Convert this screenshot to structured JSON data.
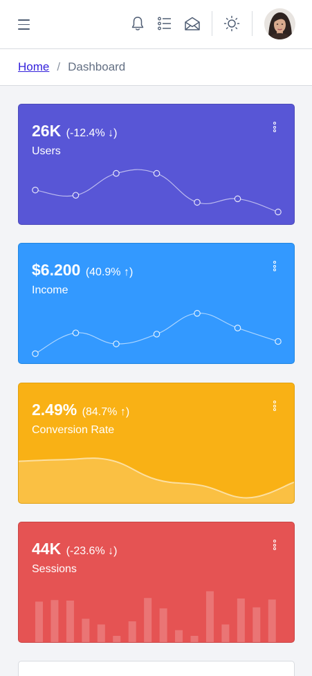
{
  "header": {
    "menu_icon": "hamburger-icon",
    "icons": [
      "bell-icon",
      "list-icon",
      "envelope-open-icon",
      "sun-icon"
    ],
    "avatar": "user-avatar"
  },
  "breadcrumb": {
    "home": "Home",
    "separator": "/",
    "current": "Dashboard"
  },
  "widgets": [
    {
      "value": "26K",
      "change": "(-12.4% ↓)",
      "label": "Users",
      "color": "#5856d6",
      "border_color": "#4b49b8",
      "chart": {
        "type": "line",
        "values": [
          65,
          59,
          84,
          84,
          51,
          55,
          40
        ],
        "ylim": [
          30,
          90
        ]
      }
    },
    {
      "value": "$6.200",
      "change": "(40.9% ↑)",
      "label": "Income",
      "color": "#39f",
      "border_color": "#1f86e0",
      "chart": {
        "type": "line",
        "values": [
          1,
          18,
          9,
          17,
          34,
          22,
          11
        ],
        "ylim": [
          -4,
          39
        ]
      }
    },
    {
      "value": "2.49%",
      "change": "(84.7% ↑)",
      "label": "Conversion Rate",
      "color": "#f9b115",
      "border_color": "#e1a00f",
      "chart": {
        "type": "area",
        "values": [
          78,
          81,
          80,
          45,
          34,
          12,
          40
        ],
        "ylim": [
          0,
          100
        ]
      }
    },
    {
      "value": "44K",
      "change": "(-23.6% ↓)",
      "label": "Sessions",
      "color": "#e55353",
      "border_color": "#c94444",
      "chart": {
        "type": "bar",
        "values": [
          78,
          81,
          80,
          45,
          34,
          12,
          40,
          85,
          65,
          23,
          12,
          98,
          34,
          84,
          67,
          82
        ],
        "ylim": [
          0,
          100
        ]
      }
    }
  ]
}
